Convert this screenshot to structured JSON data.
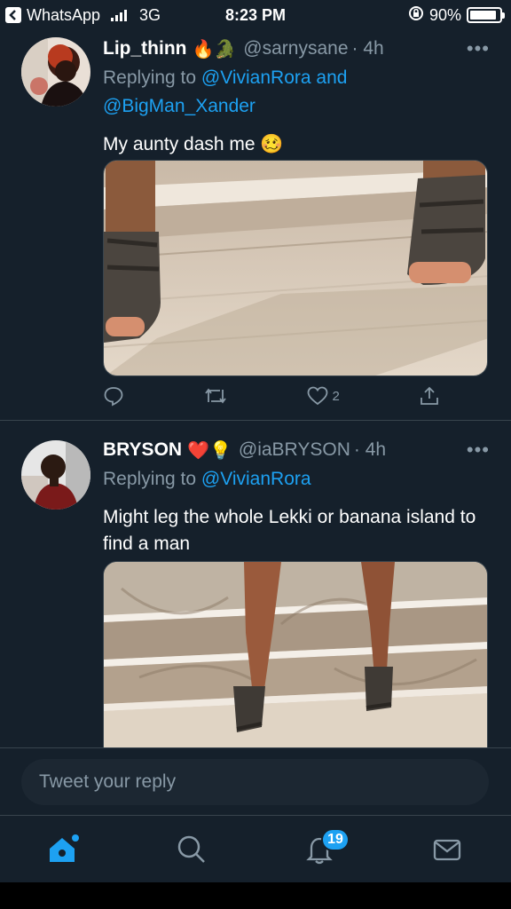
{
  "status_bar": {
    "back_app": "WhatsApp",
    "network": "3G",
    "time": "8:23 PM",
    "battery": "90%",
    "battery_level": 0.9
  },
  "tweets": [
    {
      "name": "Lip_thinn",
      "emojis": "🔥🐊",
      "handle": "@sarnysane",
      "time": "· 4h",
      "replying_prefix": "Replying to",
      "mention1": "@VivianRora",
      "and_word": "and",
      "mention2": "@BigMan_Xander",
      "text": "My aunty dash me 🥴",
      "like_count": "2",
      "image_alt": "photo-feet-in-sandals"
    },
    {
      "name": "BRYSON",
      "emojis": "❤️💡",
      "handle": "@iaBRYSON",
      "time": "· 4h",
      "replying_prefix": "Replying to",
      "mention1": "@VivianRora",
      "text": "Might leg the whole Lekki or banana island to find a man",
      "image_alt": "photo-legs-on-steps"
    }
  ],
  "reply": {
    "placeholder": "Tweet your reply"
  },
  "tabbar": {
    "notifications_badge": "19"
  },
  "colors": {
    "background": "#15202b",
    "accent": "#1da1f2",
    "secondary_text": "#8899a6"
  }
}
